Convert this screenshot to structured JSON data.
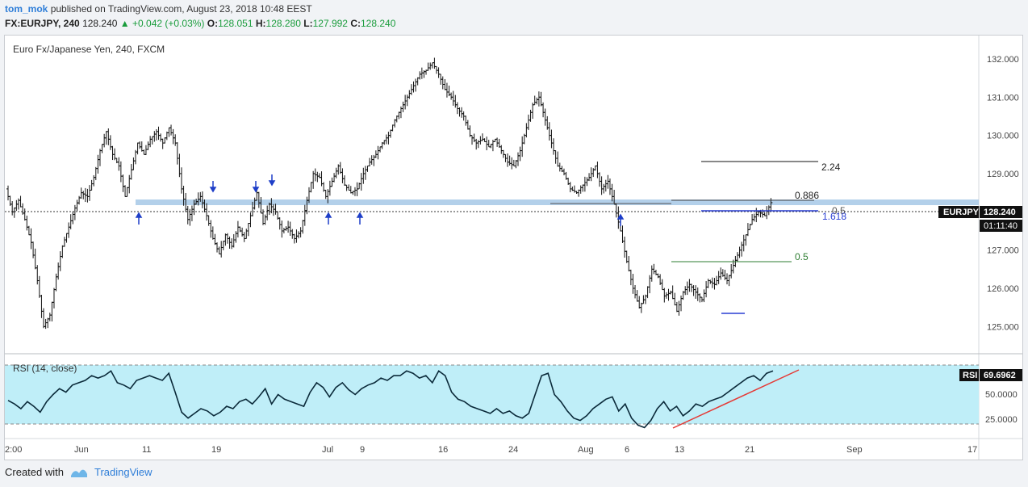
{
  "header": {
    "user": "tom_mok",
    "published": "published on TradingView.com, August 23, 2018 10:48 EEST",
    "symbol": "FX:EURJPY, 240",
    "last": "128.240",
    "change_arrow": "▲",
    "change": "+0.042 (+0.03%)",
    "o_label": "O:",
    "o": "128.051",
    "h_label": "H:",
    "h": "128.280",
    "l_label": "L:",
    "l": "127.992",
    "c_label": "C:",
    "c": "128.240"
  },
  "chart_data": {
    "type": "candlestick",
    "title": "Euro Fx/Japanese Yen, 240, FXCM",
    "ylim": [
      124.5,
      132.4
    ],
    "y_ticks": [
      "132.000",
      "131.000",
      "130.000",
      "129.000",
      "128.000",
      "127.000",
      "126.000",
      "125.000"
    ],
    "x_ticks": [
      "2:00",
      "Jun",
      "11",
      "19",
      "Jul",
      "9",
      "16",
      "24",
      "Aug",
      "6",
      "13",
      "21",
      "Sep",
      "17"
    ],
    "last_price_label": "EURJPY",
    "last_price": "128.240",
    "countdown": "01:11:40",
    "price_path": [
      [
        128.6,
        128.0
      ],
      [
        128.0,
        128.3
      ],
      [
        128.3,
        127.8
      ],
      [
        127.8,
        127.2
      ],
      [
        127.2,
        126.2
      ],
      [
        126.2,
        125.0
      ],
      [
        125.0,
        125.3
      ],
      [
        125.3,
        126.3
      ],
      [
        126.3,
        127.1
      ],
      [
        127.1,
        127.6
      ],
      [
        127.6,
        128.1
      ],
      [
        128.1,
        128.5
      ],
      [
        128.5,
        128.4
      ],
      [
        128.4,
        128.9
      ],
      [
        128.9,
        129.6
      ],
      [
        129.6,
        130.1
      ],
      [
        130.1,
        129.5
      ],
      [
        129.5,
        129.2
      ],
      [
        129.2,
        128.4
      ],
      [
        128.4,
        129.1
      ],
      [
        129.1,
        129.8
      ],
      [
        129.8,
        129.5
      ],
      [
        129.5,
        129.9
      ],
      [
        129.9,
        130.1
      ],
      [
        130.1,
        129.8
      ],
      [
        129.8,
        130.2
      ],
      [
        130.2,
        129.8
      ],
      [
        129.8,
        128.6
      ],
      [
        128.6,
        127.8
      ],
      [
        127.8,
        128.2
      ],
      [
        128.2,
        128.4
      ],
      [
        128.4,
        127.9
      ],
      [
        127.9,
        127.3
      ],
      [
        127.3,
        126.9
      ],
      [
        126.9,
        127.4
      ],
      [
        127.4,
        127.1
      ],
      [
        127.1,
        127.6
      ],
      [
        127.6,
        127.3
      ],
      [
        127.3,
        127.9
      ],
      [
        127.9,
        128.5
      ],
      [
        128.5,
        127.7
      ],
      [
        127.7,
        128.2
      ],
      [
        128.2,
        128.0
      ],
      [
        128.0,
        127.5
      ],
      [
        127.5,
        127.6
      ],
      [
        127.6,
        127.3
      ],
      [
        127.3,
        127.5
      ],
      [
        127.5,
        128.3
      ],
      [
        128.3,
        129.0
      ],
      [
        129.0,
        128.9
      ],
      [
        128.9,
        128.4
      ],
      [
        128.4,
        128.8
      ],
      [
        128.8,
        129.2
      ],
      [
        129.2,
        128.7
      ],
      [
        128.7,
        128.5
      ],
      [
        128.5,
        128.6
      ],
      [
        128.6,
        129.0
      ],
      [
        129.0,
        129.3
      ],
      [
        129.3,
        129.5
      ],
      [
        129.5,
        129.8
      ],
      [
        129.8,
        130.0
      ],
      [
        130.0,
        130.4
      ],
      [
        130.4,
        130.7
      ],
      [
        130.7,
        131.0
      ],
      [
        131.0,
        131.3
      ],
      [
        131.3,
        131.6
      ],
      [
        131.6,
        131.7
      ],
      [
        131.7,
        131.9
      ],
      [
        131.9,
        131.6
      ],
      [
        131.6,
        131.2
      ],
      [
        131.2,
        131.0
      ],
      [
        131.0,
        130.7
      ],
      [
        130.7,
        130.5
      ],
      [
        130.5,
        130.0
      ],
      [
        130.0,
        129.8
      ],
      [
        129.8,
        129.9
      ],
      [
        129.9,
        129.7
      ],
      [
        129.7,
        129.9
      ],
      [
        129.9,
        129.6
      ],
      [
        129.6,
        129.3
      ],
      [
        129.3,
        129.2
      ],
      [
        129.2,
        129.6
      ],
      [
        129.6,
        130.2
      ],
      [
        130.2,
        130.8
      ],
      [
        130.8,
        131.0
      ],
      [
        131.0,
        130.4
      ],
      [
        130.4,
        129.8
      ],
      [
        129.8,
        129.2
      ],
      [
        129.2,
        129.0
      ],
      [
        129.0,
        128.6
      ],
      [
        128.6,
        128.5
      ],
      [
        128.5,
        128.7
      ],
      [
        128.7,
        128.9
      ],
      [
        128.9,
        129.2
      ],
      [
        129.2,
        128.6
      ],
      [
        128.6,
        128.8
      ],
      [
        128.8,
        128.2
      ],
      [
        128.2,
        127.5
      ],
      [
        127.5,
        126.7
      ],
      [
        126.7,
        126.0
      ],
      [
        126.0,
        125.5
      ],
      [
        125.5,
        125.8
      ],
      [
        125.8,
        126.5
      ],
      [
        126.5,
        126.3
      ],
      [
        126.3,
        125.8
      ],
      [
        125.8,
        125.9
      ],
      [
        125.9,
        125.4
      ],
      [
        125.4,
        125.9
      ],
      [
        125.9,
        126.1
      ],
      [
        126.1,
        125.9
      ],
      [
        125.9,
        125.7
      ],
      [
        125.7,
        126.2
      ],
      [
        126.2,
        126.1
      ],
      [
        126.1,
        126.4
      ],
      [
        126.4,
        126.2
      ],
      [
        126.2,
        126.6
      ],
      [
        126.6,
        127.0
      ],
      [
        127.0,
        127.4
      ],
      [
        127.4,
        127.8
      ],
      [
        127.8,
        128.0
      ],
      [
        128.0,
        127.9
      ],
      [
        127.9,
        128.24
      ]
    ],
    "rsi_path": [
      45,
      42,
      38,
      44,
      40,
      35,
      44,
      50,
      55,
      52,
      58,
      60,
      62,
      66,
      64,
      66,
      70,
      60,
      58,
      55,
      62,
      64,
      66,
      64,
      62,
      68,
      52,
      35,
      30,
      34,
      38,
      36,
      32,
      35,
      40,
      38,
      44,
      46,
      42,
      48,
      55,
      42,
      50,
      46,
      44,
      42,
      40,
      52,
      60,
      56,
      48,
      56,
      60,
      54,
      50,
      55,
      58,
      60,
      64,
      62,
      66,
      66,
      70,
      68,
      64,
      66,
      60,
      70,
      66,
      52,
      46,
      44,
      40,
      38,
      36,
      34,
      38,
      34,
      36,
      32,
      30,
      34,
      50,
      66,
      68,
      50,
      44,
      36,
      30,
      28,
      32,
      38,
      42,
      46,
      48,
      36,
      42,
      30,
      24,
      22,
      28,
      38,
      44,
      36,
      40,
      32,
      36,
      42,
      40,
      44,
      46,
      48,
      52,
      56,
      60,
      64,
      66,
      62,
      68,
      70
    ],
    "annotations": {
      "fib_labels": [
        "2.24",
        "0.886",
        "0.5",
        "1.618",
        "0.5"
      ],
      "rsi_title": "RSI (14, close)",
      "rsi_label": "RSI",
      "rsi_value": "69.6962",
      "rsi_ticks": [
        "50.0000",
        "25.0000"
      ]
    },
    "colors": {
      "zone": "#a6c8e6",
      "rsi_band": "#bfeef8",
      "trendline": "#e53935",
      "arrow": "#1e3ec8",
      "fib_05_green": "#2e7d32",
      "fib_1618_blue": "#2a3fd4"
    }
  },
  "footer": {
    "created_with": "Created with",
    "brand": "TradingView"
  }
}
